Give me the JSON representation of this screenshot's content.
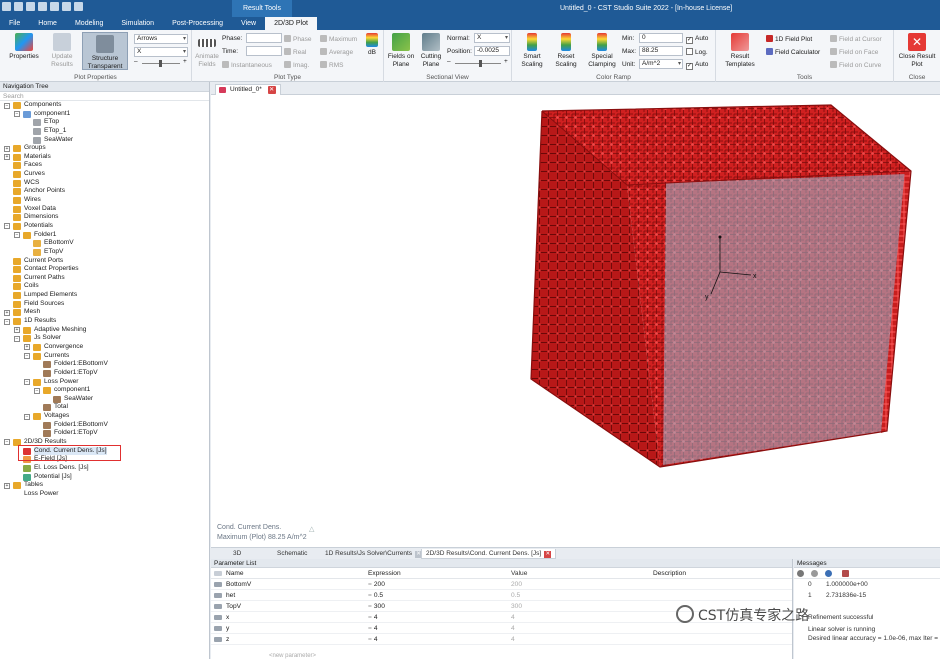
{
  "window": {
    "context_tab_title": "Result Tools",
    "title": "Untitled_0 - CST Studio Suite 2022 - [In-house License]"
  },
  "menu": [
    "File",
    "Home",
    "Modeling",
    "Simulation",
    "Post-Processing",
    "View",
    "2D/3D Plot"
  ],
  "ribbon": {
    "plot_properties": {
      "label": "Plot Properties",
      "properties": "Properties",
      "update_results": "Update Results",
      "structure_transparent": "Structure Transparent",
      "dropdown_1": "Arrows",
      "dropdown_2": "X"
    },
    "plot_type": {
      "label": "Plot Type",
      "animate_fields": "Animate Fields",
      "phase_label": "Phase:",
      "time_label": "Time:",
      "phase_chk": "Phase",
      "maximum": "Maximum",
      "real": "Real",
      "average": "Average",
      "imag": "Imag.",
      "rms": "RMS",
      "instantaneous": "Instantaneous",
      "db": "dB"
    },
    "sectional_view": {
      "label": "Sectional View",
      "fields_on_plane": "Fields on Plane",
      "cutting_plane": "Cutting Plane",
      "normal_label": "Normal:",
      "normal_value": "X",
      "position_label": "Position:",
      "position_value": "-0.0025"
    },
    "color_ramp": {
      "label": "Color Ramp",
      "smart_scaling": "Smart Scaling",
      "reset_scaling": "Reset Scaling",
      "special_clamping": "Special Clamping",
      "min_label": "Min:",
      "min_value": "0",
      "max_label": "Max:",
      "max_value": "88.25",
      "unit_label": "Unit:",
      "unit_value": "A/m^2",
      "auto1": "Auto",
      "log": "Log.",
      "auto2": "Auto"
    },
    "tools": {
      "label": "Tools",
      "result_templates": "Result Templates",
      "field_plot_1d": "1D Field Plot",
      "field_calculator": "Field Calculator",
      "field_at_cursor": "Field at Cursor",
      "field_on_face": "Field on Face",
      "field_on_curve": "Field on Curve"
    },
    "close": {
      "label": "Close",
      "close_result_plot": "Close Result Plot"
    }
  },
  "nav": {
    "title": "Navigation Tree",
    "search_placeholder": "Search",
    "items": [
      {
        "label": "Components",
        "indent": 0,
        "toggle": "-",
        "icon": "folder"
      },
      {
        "label": "component1",
        "indent": 1,
        "toggle": "-",
        "icon": "component"
      },
      {
        "label": "ETop",
        "indent": 2,
        "toggle": "",
        "icon": "solid"
      },
      {
        "label": "ETop_1",
        "indent": 2,
        "toggle": "",
        "icon": "solid"
      },
      {
        "label": "SeaWater",
        "indent": 2,
        "toggle": "",
        "icon": "solid"
      },
      {
        "label": "Groups",
        "indent": 0,
        "toggle": "+",
        "icon": "folder"
      },
      {
        "label": "Materials",
        "indent": 0,
        "toggle": "+",
        "icon": "folder"
      },
      {
        "label": "Faces",
        "indent": 0,
        "toggle": "",
        "icon": "folder"
      },
      {
        "label": "Curves",
        "indent": 0,
        "toggle": "",
        "icon": "folder"
      },
      {
        "label": "WCS",
        "indent": 0,
        "toggle": "",
        "icon": "folder"
      },
      {
        "label": "Anchor Points",
        "indent": 0,
        "toggle": "",
        "icon": "folder"
      },
      {
        "label": "Wires",
        "indent": 0,
        "toggle": "",
        "icon": "folder"
      },
      {
        "label": "Voxel Data",
        "indent": 0,
        "toggle": "",
        "icon": "folder"
      },
      {
        "label": "Dimensions",
        "indent": 0,
        "toggle": "",
        "icon": "folder"
      },
      {
        "label": "Potentials",
        "indent": 0,
        "toggle": "-",
        "icon": "folder"
      },
      {
        "label": "Folder1",
        "indent": 1,
        "toggle": "-",
        "icon": "folder"
      },
      {
        "label": "EBottomV",
        "indent": 2,
        "toggle": "",
        "icon": "potential"
      },
      {
        "label": "ETopV",
        "indent": 2,
        "toggle": "",
        "icon": "potential"
      },
      {
        "label": "Current Ports",
        "indent": 0,
        "toggle": "",
        "icon": "folder"
      },
      {
        "label": "Contact Properties",
        "indent": 0,
        "toggle": "",
        "icon": "folder"
      },
      {
        "label": "Current Paths",
        "indent": 0,
        "toggle": "",
        "icon": "folder"
      },
      {
        "label": "Coils",
        "indent": 0,
        "toggle": "",
        "icon": "folder"
      },
      {
        "label": "Lumped Elements",
        "indent": 0,
        "toggle": "",
        "icon": "folder"
      },
      {
        "label": "Field Sources",
        "indent": 0,
        "toggle": "",
        "icon": "folder"
      },
      {
        "label": "Mesh",
        "indent": 0,
        "toggle": "+",
        "icon": "folder"
      },
      {
        "label": "1D Results",
        "indent": 0,
        "toggle": "-",
        "icon": "folder"
      },
      {
        "label": "Adaptive Meshing",
        "indent": 1,
        "toggle": "+",
        "icon": "folder"
      },
      {
        "label": "Js Solver",
        "indent": 1,
        "toggle": "-",
        "icon": "folder"
      },
      {
        "label": "Convergence",
        "indent": 2,
        "toggle": "+",
        "icon": "folder"
      },
      {
        "label": "Currents",
        "indent": 2,
        "toggle": "-",
        "icon": "folder"
      },
      {
        "label": "Folder1:EBottomV",
        "indent": 3,
        "toggle": "",
        "icon": "result1d"
      },
      {
        "label": "Folder1:ETopV",
        "indent": 3,
        "toggle": "",
        "icon": "result1d"
      },
      {
        "label": "Loss Power",
        "indent": 2,
        "toggle": "-",
        "icon": "folder"
      },
      {
        "label": "component1",
        "indent": 3,
        "toggle": "-",
        "icon": "folder"
      },
      {
        "label": "SeaWater",
        "indent": 4,
        "toggle": "",
        "icon": "result1d"
      },
      {
        "label": "Total",
        "indent": 3,
        "toggle": "",
        "icon": "result1d"
      },
      {
        "label": "Voltages",
        "indent": 2,
        "toggle": "-",
        "icon": "folder"
      },
      {
        "label": "Folder1:EBottomV",
        "indent": 3,
        "toggle": "",
        "icon": "result1d"
      },
      {
        "label": "Folder1:ETopV",
        "indent": 3,
        "toggle": "",
        "icon": "result1d"
      },
      {
        "label": "2D/3D Results",
        "indent": 0,
        "toggle": "-",
        "icon": "folder"
      },
      {
        "label": "Cond. Current Dens. [Js]",
        "indent": 1,
        "toggle": "",
        "icon": "field-current",
        "selected": true
      },
      {
        "label": "E-Field [Js]",
        "indent": 1,
        "toggle": "",
        "icon": "field-e"
      },
      {
        "label": "El. Loss Dens. [Js]",
        "indent": 1,
        "toggle": "",
        "icon": "field-loss"
      },
      {
        "label": "Potential [Js]",
        "indent": 1,
        "toggle": "",
        "icon": "field-pot"
      },
      {
        "label": "Tables",
        "indent": 0,
        "toggle": "+",
        "icon": "folder"
      },
      {
        "label": "Loss Power",
        "indent": 0,
        "toggle": "",
        "icon": "none"
      }
    ]
  },
  "doc_tab": "Untitled_0*",
  "viewport": {
    "plot_name": "Cond. Current Dens.",
    "plot_max": "Maximum (Plot)  88.25 A/m^2"
  },
  "view_tabs": [
    "3D",
    "Schematic",
    "1D Results\\Js Solver\\Currents",
    "2D/3D Results\\Cond. Current Dens. [Js]"
  ],
  "params": {
    "title": "Parameter List",
    "headers": [
      "Name",
      "Expression",
      "Value",
      "Description"
    ],
    "rows": [
      {
        "name": "BottomV",
        "expr": "200",
        "value": "200"
      },
      {
        "name": "het",
        "expr": "0.5",
        "value": "0.5"
      },
      {
        "name": "TopV",
        "expr": "300",
        "value": "300"
      },
      {
        "name": "x",
        "expr": "4",
        "value": "4"
      },
      {
        "name": "y",
        "expr": "4",
        "value": "4"
      },
      {
        "name": "z",
        "expr": "4",
        "value": "4"
      }
    ],
    "new_parameter": "<new parameter>"
  },
  "messages": {
    "title": "Messages",
    "rows": [
      {
        "k": "0",
        "v": "1.000000e+00"
      },
      {
        "k": "1",
        "v": "2.731836e-15"
      }
    ],
    "refinement": "Refinement successful",
    "solver_line1": "Linear solver is running",
    "solver_line2": "Desired linear accuracy = 1.0e-06, max Iter = 120"
  },
  "watermark": "CST仿真专家之路",
  "colors": {
    "titlebar": "#1f5a96",
    "accent": "#2e74b5",
    "cube_red": "#c81e1e",
    "cube_face": "#a9c0d4",
    "selection": "#e03030"
  }
}
